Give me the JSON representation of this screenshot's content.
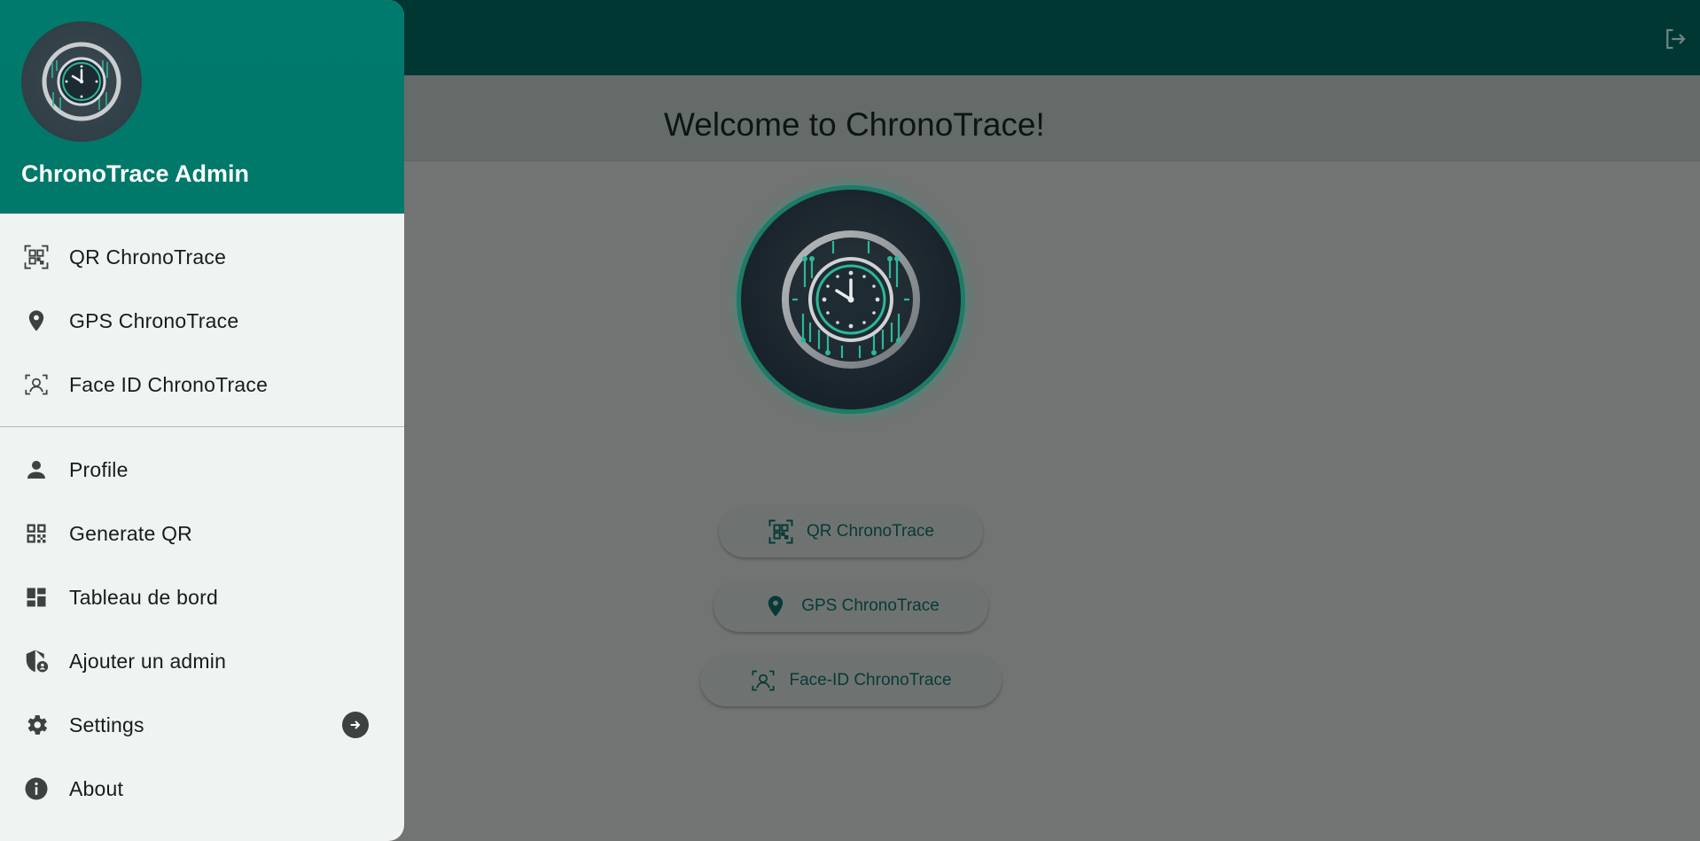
{
  "app": {
    "page_title": "Welcome to ChronoTrace!",
    "accent": "#00796b",
    "logout_icon": "logout-icon"
  },
  "main": {
    "buttons": [
      {
        "label": "QR ChronoTrace",
        "icon": "qr-scan-icon"
      },
      {
        "label": "GPS ChronoTrace",
        "icon": "location-pin-icon"
      },
      {
        "label": "Face-ID ChronoTrace",
        "icon": "face-id-icon"
      }
    ]
  },
  "drawer": {
    "header": {
      "name": "ChronoTrace Admin",
      "avatar": "chronotrace-logo"
    },
    "items": [
      {
        "label": "QR ChronoTrace",
        "icon": "qr-scan-icon"
      },
      {
        "label": "GPS ChronoTrace",
        "icon": "location-pin-icon"
      },
      {
        "label": "Face ID ChronoTrace",
        "icon": "face-id-icon"
      },
      {
        "label": "Profile",
        "icon": "person-icon"
      },
      {
        "label": "Generate QR",
        "icon": "qr-code-icon"
      },
      {
        "label": "Tableau de bord",
        "icon": "dashboard-icon"
      },
      {
        "label": "Ajouter un admin",
        "icon": "admin-shield-icon"
      },
      {
        "label": "Settings",
        "icon": "gear-icon",
        "trailing_icon": "arrow-right-circle-icon"
      },
      {
        "label": "About",
        "icon": "info-icon"
      }
    ]
  }
}
